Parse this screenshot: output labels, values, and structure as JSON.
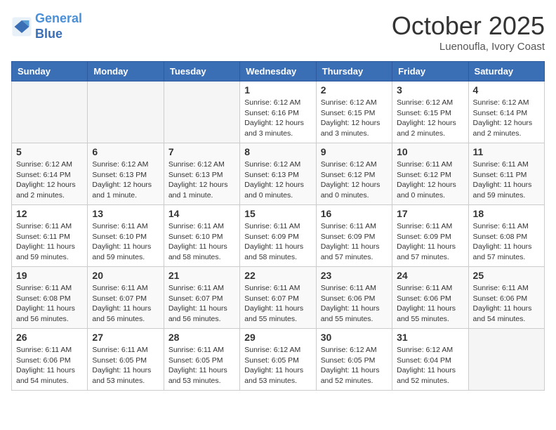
{
  "header": {
    "logo_line1": "General",
    "logo_line2": "Blue",
    "month_title": "October 2025",
    "location": "Luenoufla, Ivory Coast"
  },
  "weekdays": [
    "Sunday",
    "Monday",
    "Tuesday",
    "Wednesday",
    "Thursday",
    "Friday",
    "Saturday"
  ],
  "weeks": [
    [
      {
        "day": "",
        "text": ""
      },
      {
        "day": "",
        "text": ""
      },
      {
        "day": "",
        "text": ""
      },
      {
        "day": "1",
        "text": "Sunrise: 6:12 AM\nSunset: 6:16 PM\nDaylight: 12 hours\nand 3 minutes."
      },
      {
        "day": "2",
        "text": "Sunrise: 6:12 AM\nSunset: 6:15 PM\nDaylight: 12 hours\nand 3 minutes."
      },
      {
        "day": "3",
        "text": "Sunrise: 6:12 AM\nSunset: 6:15 PM\nDaylight: 12 hours\nand 2 minutes."
      },
      {
        "day": "4",
        "text": "Sunrise: 6:12 AM\nSunset: 6:14 PM\nDaylight: 12 hours\nand 2 minutes."
      }
    ],
    [
      {
        "day": "5",
        "text": "Sunrise: 6:12 AM\nSunset: 6:14 PM\nDaylight: 12 hours\nand 2 minutes."
      },
      {
        "day": "6",
        "text": "Sunrise: 6:12 AM\nSunset: 6:13 PM\nDaylight: 12 hours\nand 1 minute."
      },
      {
        "day": "7",
        "text": "Sunrise: 6:12 AM\nSunset: 6:13 PM\nDaylight: 12 hours\nand 1 minute."
      },
      {
        "day": "8",
        "text": "Sunrise: 6:12 AM\nSunset: 6:13 PM\nDaylight: 12 hours\nand 0 minutes."
      },
      {
        "day": "9",
        "text": "Sunrise: 6:12 AM\nSunset: 6:12 PM\nDaylight: 12 hours\nand 0 minutes."
      },
      {
        "day": "10",
        "text": "Sunrise: 6:11 AM\nSunset: 6:12 PM\nDaylight: 12 hours\nand 0 minutes."
      },
      {
        "day": "11",
        "text": "Sunrise: 6:11 AM\nSunset: 6:11 PM\nDaylight: 11 hours\nand 59 minutes."
      }
    ],
    [
      {
        "day": "12",
        "text": "Sunrise: 6:11 AM\nSunset: 6:11 PM\nDaylight: 11 hours\nand 59 minutes."
      },
      {
        "day": "13",
        "text": "Sunrise: 6:11 AM\nSunset: 6:10 PM\nDaylight: 11 hours\nand 59 minutes."
      },
      {
        "day": "14",
        "text": "Sunrise: 6:11 AM\nSunset: 6:10 PM\nDaylight: 11 hours\nand 58 minutes."
      },
      {
        "day": "15",
        "text": "Sunrise: 6:11 AM\nSunset: 6:09 PM\nDaylight: 11 hours\nand 58 minutes."
      },
      {
        "day": "16",
        "text": "Sunrise: 6:11 AM\nSunset: 6:09 PM\nDaylight: 11 hours\nand 57 minutes."
      },
      {
        "day": "17",
        "text": "Sunrise: 6:11 AM\nSunset: 6:09 PM\nDaylight: 11 hours\nand 57 minutes."
      },
      {
        "day": "18",
        "text": "Sunrise: 6:11 AM\nSunset: 6:08 PM\nDaylight: 11 hours\nand 57 minutes."
      }
    ],
    [
      {
        "day": "19",
        "text": "Sunrise: 6:11 AM\nSunset: 6:08 PM\nDaylight: 11 hours\nand 56 minutes."
      },
      {
        "day": "20",
        "text": "Sunrise: 6:11 AM\nSunset: 6:07 PM\nDaylight: 11 hours\nand 56 minutes."
      },
      {
        "day": "21",
        "text": "Sunrise: 6:11 AM\nSunset: 6:07 PM\nDaylight: 11 hours\nand 56 minutes."
      },
      {
        "day": "22",
        "text": "Sunrise: 6:11 AM\nSunset: 6:07 PM\nDaylight: 11 hours\nand 55 minutes."
      },
      {
        "day": "23",
        "text": "Sunrise: 6:11 AM\nSunset: 6:06 PM\nDaylight: 11 hours\nand 55 minutes."
      },
      {
        "day": "24",
        "text": "Sunrise: 6:11 AM\nSunset: 6:06 PM\nDaylight: 11 hours\nand 55 minutes."
      },
      {
        "day": "25",
        "text": "Sunrise: 6:11 AM\nSunset: 6:06 PM\nDaylight: 11 hours\nand 54 minutes."
      }
    ],
    [
      {
        "day": "26",
        "text": "Sunrise: 6:11 AM\nSunset: 6:06 PM\nDaylight: 11 hours\nand 54 minutes."
      },
      {
        "day": "27",
        "text": "Sunrise: 6:11 AM\nSunset: 6:05 PM\nDaylight: 11 hours\nand 53 minutes."
      },
      {
        "day": "28",
        "text": "Sunrise: 6:11 AM\nSunset: 6:05 PM\nDaylight: 11 hours\nand 53 minutes."
      },
      {
        "day": "29",
        "text": "Sunrise: 6:12 AM\nSunset: 6:05 PM\nDaylight: 11 hours\nand 53 minutes."
      },
      {
        "day": "30",
        "text": "Sunrise: 6:12 AM\nSunset: 6:05 PM\nDaylight: 11 hours\nand 52 minutes."
      },
      {
        "day": "31",
        "text": "Sunrise: 6:12 AM\nSunset: 6:04 PM\nDaylight: 11 hours\nand 52 minutes."
      },
      {
        "day": "",
        "text": ""
      }
    ]
  ]
}
